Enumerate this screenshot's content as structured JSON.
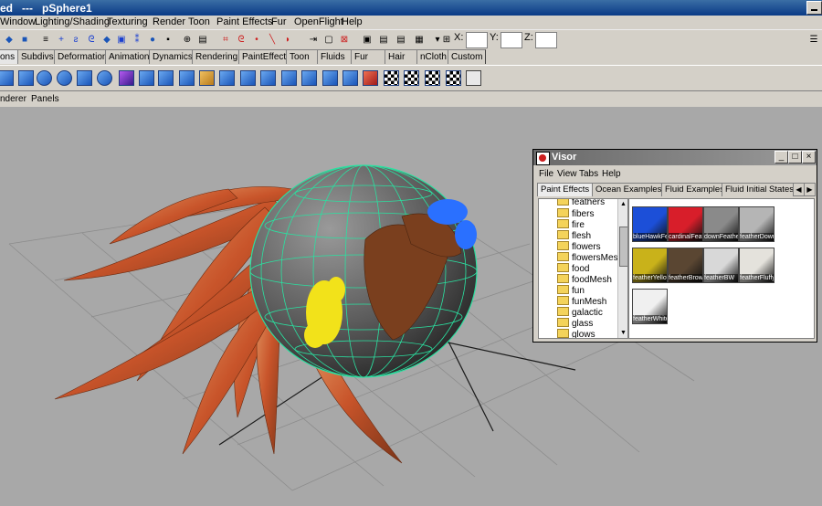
{
  "window": {
    "title": "ed   ---   pSphere1"
  },
  "menu": [
    "Window",
    "Lighting/Shading",
    "Texturing",
    "Render",
    "Toon",
    "Paint Effects",
    "Fur",
    "OpenFlight",
    "Help"
  ],
  "status_fields": {
    "x_label": "X:",
    "y_label": "Y:",
    "z_label": "Z:"
  },
  "shelf_tabs": [
    "ons",
    "Subdivs",
    "Deformation",
    "Animation",
    "Dynamics",
    "Rendering",
    "PaintEffects",
    "Toon",
    "Fluids",
    "Fur",
    "Hair",
    "nCloth",
    "Custom"
  ],
  "panel_menu": [
    "nderer",
    "Panels"
  ],
  "visor": {
    "title": "Visor",
    "menu": [
      "File",
      "View",
      "Tabs",
      "Help"
    ],
    "tabs": [
      "Paint Effects",
      "Ocean Examples",
      "Fluid Examples",
      "Fluid Initial States"
    ],
    "folders": [
      "feathers",
      "fibers",
      "fire",
      "flesh",
      "flowers",
      "flowersMesh",
      "food",
      "foodMesh",
      "fun",
      "funMesh",
      "galactic",
      "glass",
      "glows"
    ],
    "thumbnails": [
      {
        "label": "blueHawkFeather",
        "color": "#1c4fd8"
      },
      {
        "label": "cardinalFeather",
        "color": "#d81e2a"
      },
      {
        "label": "downFeather",
        "color": "#8a8a8a"
      },
      {
        "label": "featherDown",
        "color": "#b5b5b5"
      },
      {
        "label": "featherYellow",
        "color": "#c9b21a"
      },
      {
        "label": "featherBrown",
        "color": "#5a4632"
      },
      {
        "label": "featherBW",
        "color": "#d8d8d8"
      },
      {
        "label": "featherFluffy",
        "color": "#e4e2dc"
      },
      {
        "label": "featherWhite",
        "color": "#f0f0f0"
      }
    ]
  }
}
